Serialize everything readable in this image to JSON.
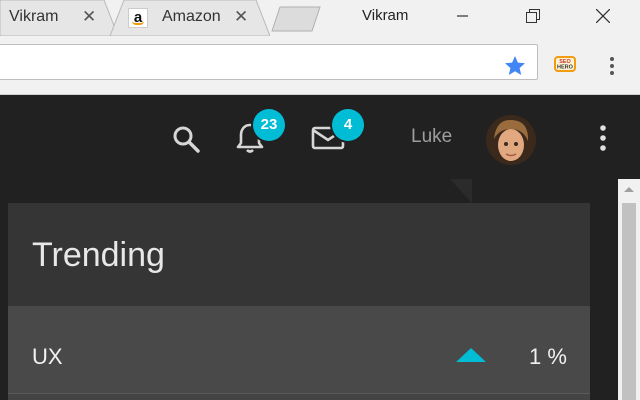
{
  "browser": {
    "tabs": [
      {
        "title": "Vikram",
        "close": "✕"
      },
      {
        "title": "Amazon",
        "close": "✕",
        "favicon": "a"
      }
    ],
    "window_title": "Vikram",
    "extension_label": "SEO HERO"
  },
  "header": {
    "notifications_count": "23",
    "messages_count": "4",
    "username": "Luke"
  },
  "trending": {
    "title": "Trending",
    "rows": [
      {
        "label": "UX",
        "value": "1 %",
        "direction": "up"
      }
    ]
  },
  "colors": {
    "accent": "#00bcd4",
    "header_bg": "#212121",
    "card_bg": "#333333",
    "row_bg": "#494949"
  }
}
